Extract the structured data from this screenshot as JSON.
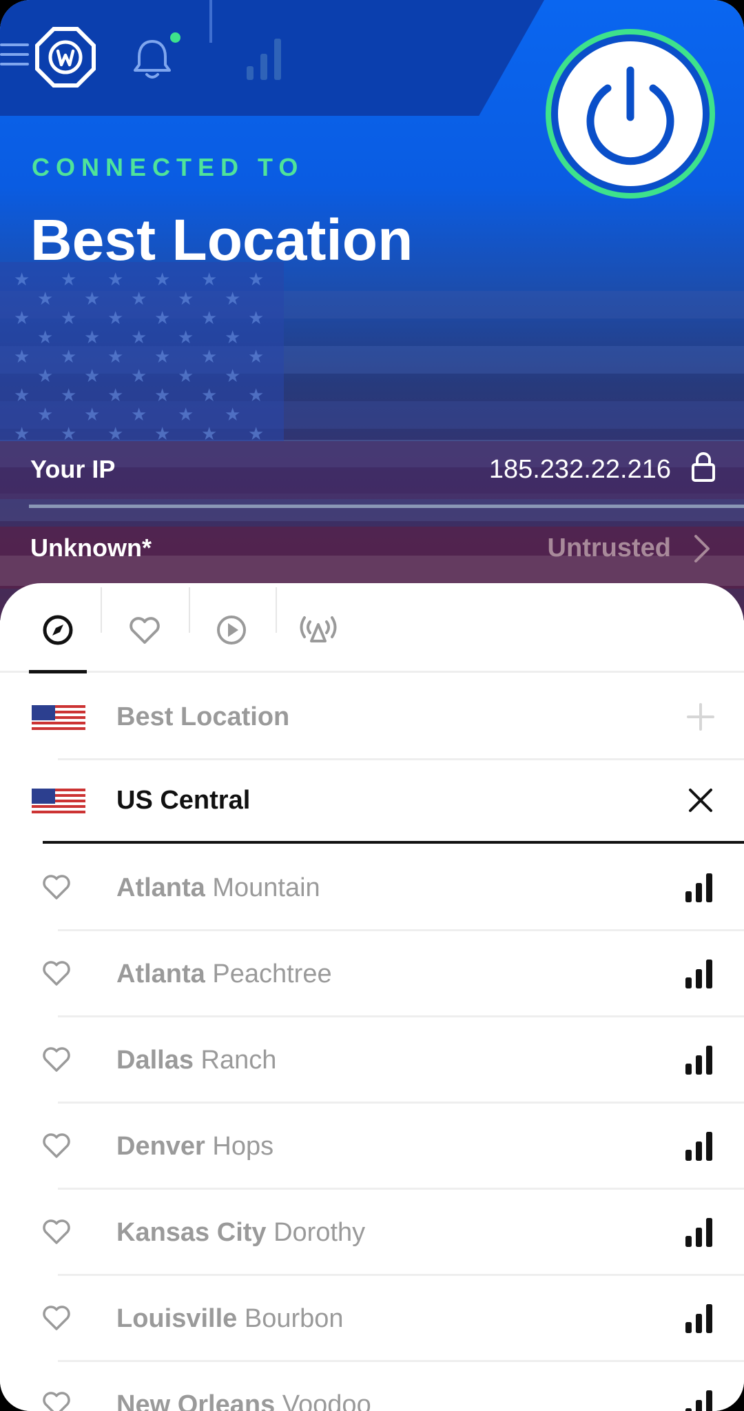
{
  "header": {
    "connected_label": "CONNECTED TO",
    "location_title": "Best Location",
    "ip_label": "Your IP",
    "ip_value": "185.232.22.216",
    "network_label": "Unknown*",
    "network_status": "Untrusted",
    "notification_dot": true
  },
  "colors": {
    "accent_green": "#3ee28c",
    "brand_blue": "#0a66f0",
    "row_text_gray": "#9a9a9a",
    "dark": "#111111"
  },
  "icons": {
    "menu": "hamburger-icon",
    "logo": "windscribe-logo-icon",
    "bell": "bell-icon",
    "signal": "signal-bars-icon",
    "power": "power-icon",
    "lock": "lock-icon",
    "chevron": "chevron-right-icon",
    "tabs": [
      "compass-icon",
      "heart-icon",
      "play-circle-icon",
      "broadcast-icon"
    ]
  },
  "locations": {
    "best": {
      "label": "Best Location"
    },
    "region": {
      "label": "US Central"
    },
    "cities": [
      {
        "city": "Atlanta",
        "node": "Mountain"
      },
      {
        "city": "Atlanta",
        "node": "Peachtree"
      },
      {
        "city": "Dallas",
        "node": "Ranch"
      },
      {
        "city": "Denver",
        "node": "Hops"
      },
      {
        "city": "Kansas City",
        "node": "Dorothy"
      },
      {
        "city": "Louisville",
        "node": "Bourbon"
      },
      {
        "city": "New Orleans",
        "node": "Voodoo"
      }
    ]
  }
}
